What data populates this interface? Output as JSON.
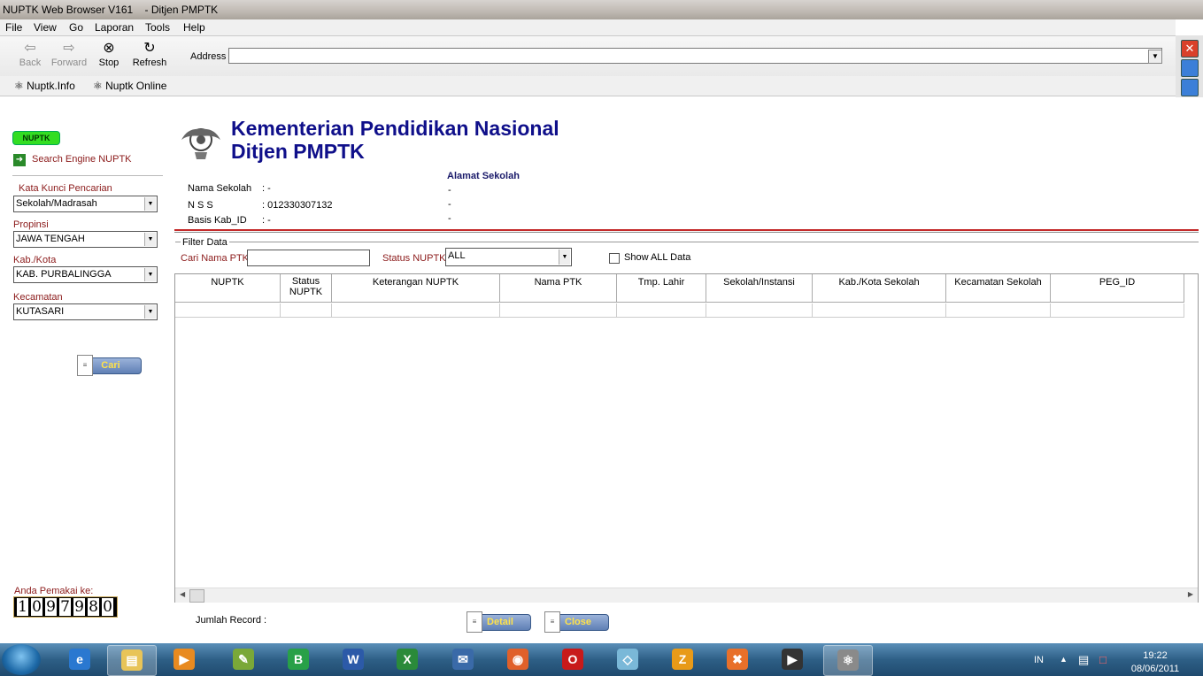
{
  "window": {
    "title": "NUPTK Web Browser V161    - Ditjen PMPTK"
  },
  "menu": {
    "items": [
      "File",
      "View",
      "Go",
      "Laporan",
      "Tools",
      "Help"
    ]
  },
  "toolbar": {
    "back_label": "Back",
    "forward_label": "Forward",
    "stop_label": "Stop",
    "refresh_label": "Refresh",
    "address_label": "Address",
    "address_value": ""
  },
  "links": {
    "items": [
      "Nuptk.Info",
      "Nuptk Online"
    ]
  },
  "sidebar": {
    "logo_text": "NUPTK",
    "search_engine_label": "Search Engine NUPTK",
    "kata_kunci_label": "Kata Kunci Pencarian",
    "kata_kunci_value": "Sekolah/Madrasah",
    "propinsi_label": "Propinsi",
    "propinsi_value": "JAWA TENGAH",
    "kabkota_label": "Kab./Kota",
    "kabkota_value": "KAB. PURBALINGGA",
    "kecamatan_label": "Kecamatan",
    "kecamatan_value": "KUTASARI",
    "cari_button": "Cari",
    "user_label": "Anda Pemakai ke:",
    "counter_digits": [
      "1",
      "0",
      "9",
      "7",
      "9",
      "8",
      "0"
    ]
  },
  "header": {
    "title1": "Kementerian Pendidikan Nasional",
    "title2": "Ditjen PMPTK"
  },
  "school": {
    "nama_label": "Nama Sekolah",
    "nama_value": ": -",
    "nss_label": "N S S",
    "nss_value": ": 012330307132",
    "basis_label": "Basis Kab_ID",
    "basis_value": ": -",
    "alamat_title": "Alamat Sekolah",
    "alamat_lines": [
      "-",
      "-",
      "-"
    ]
  },
  "filter": {
    "title": "Filter Data",
    "cari_label": "Cari Nama PTK",
    "cari_value": "",
    "status_label": "Status NUPTK",
    "status_value": "ALL",
    "show_all_label": "Show ALL Data"
  },
  "grid": {
    "columns": [
      "NUPTK",
      "Status NUPTK",
      "Keterangan NUPTK",
      "Nama PTK",
      "Tmp. Lahir",
      "Sekolah/Instansi",
      "Kab./Kota Sekolah",
      "Kecamatan Sekolah",
      "PEG_ID"
    ]
  },
  "footer": {
    "jumlah_label": "Jumlah Record :",
    "detail_button": "Detail",
    "close_button": "Close"
  },
  "taskbar": {
    "lang": "IN",
    "time": "19:22",
    "date": "08/06/2011"
  }
}
